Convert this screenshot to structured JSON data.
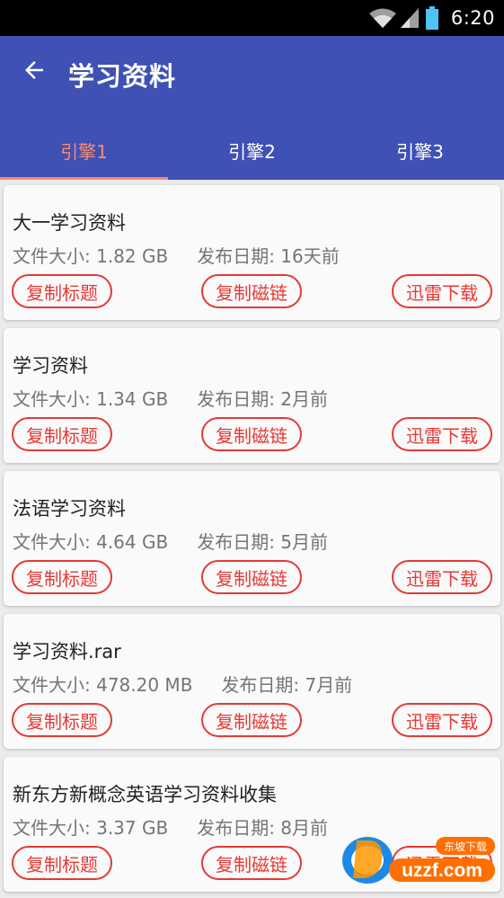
{
  "status_bar": {
    "time": "6:20"
  },
  "app_bar": {
    "title": "学习资料",
    "tabs": [
      {
        "label": "引擎1",
        "active": true
      },
      {
        "label": "引擎2",
        "active": false
      },
      {
        "label": "引擎3",
        "active": false
      }
    ]
  },
  "buttons": {
    "copy_title": "复制标题",
    "copy_magnet": "复制磁链",
    "xunlei_download": "迅雷下载"
  },
  "items": [
    {
      "title": "大一学习资料",
      "size": "文件大小:  1.82 GB",
      "date": "发布日期:  16天前"
    },
    {
      "title": "学习资料",
      "size": "文件大小:  1.34 GB",
      "date": "发布日期:  2月前"
    },
    {
      "title": "法语学习资料",
      "size": "文件大小:  4.64 GB",
      "date": "发布日期:  5月前"
    },
    {
      "title": "学习资料.rar",
      "size": "文件大小:  478.20 MB",
      "date": "发布日期:  7月前"
    },
    {
      "title": "新东方新概念英语学习资料收集",
      "size": "文件大小:  3.37 GB",
      "date": "发布日期:  8月前"
    }
  ],
  "watermark": {
    "text": "uzzf.com",
    "sub": "东坡下载"
  },
  "colors": {
    "app_bar": "#3f51b5",
    "accent": "#ff8a65",
    "button_red": "#e53935"
  }
}
